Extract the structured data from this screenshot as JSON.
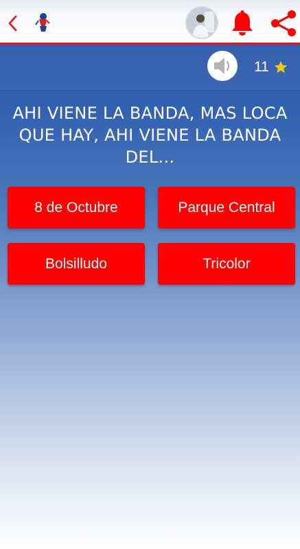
{
  "header": {
    "back_icon": "chevron-left-icon",
    "logo_icon": "club-mascot-logo",
    "avatar_icon": "user-avatar",
    "bell_icon": "bell-icon",
    "share_icon": "share-icon",
    "accent_color": "#e01b22"
  },
  "game": {
    "sound_icon": "speaker-icon",
    "score": "11",
    "score_icon": "star-icon",
    "question": "AHI VIENE LA BANDA, MAS LOCA QUE HAY, AHI VIENE LA BANDA DEL...",
    "answers": [
      {
        "label": "8 de Octubre"
      },
      {
        "label": "Parque Central"
      },
      {
        "label": "Bolsilludo"
      },
      {
        "label": "Tricolor"
      }
    ],
    "answer_color": "#fe0000"
  }
}
